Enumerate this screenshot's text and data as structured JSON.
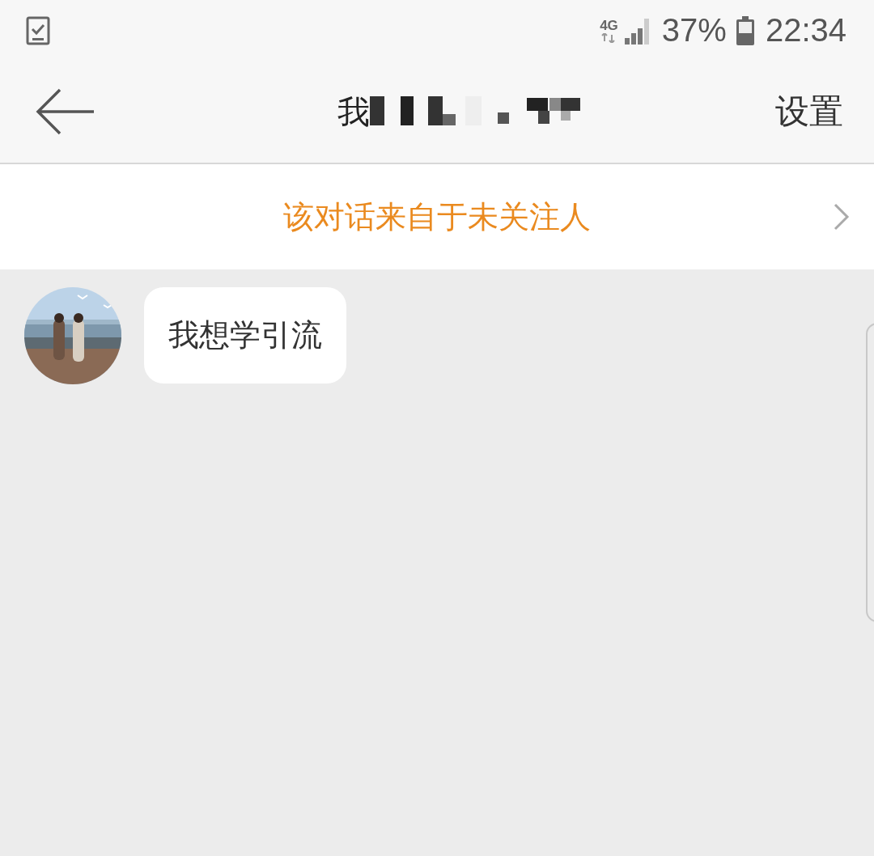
{
  "status_bar": {
    "network": "4G",
    "battery": "37%",
    "time": "22:34"
  },
  "header": {
    "title": "我",
    "action": "设置"
  },
  "notice": {
    "text": "该对话来自于未关注人"
  },
  "messages": [
    {
      "kind": "incoming",
      "text": "我想学引流"
    }
  ]
}
